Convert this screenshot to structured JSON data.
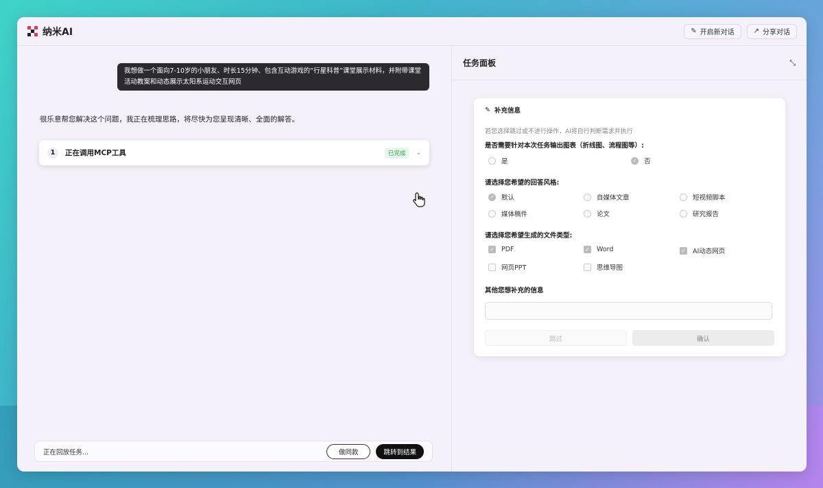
{
  "app": {
    "name": "纳米AI"
  },
  "topbar": {
    "new_chat": "开启新对话",
    "share": "分享对话"
  },
  "chat": {
    "user_message": "我想做一个面向7-10岁的小朋友、时长15分钟、包含互动游戏的“行星科普”课堂展示材料，并附带课堂活动教案和动态展示太阳系运动交互网页",
    "ai_message": "很乐意帮您解决这个问题，我正在梳理思路，将尽快为您呈现清晰、全面的解答。",
    "tool_step": {
      "number": "1",
      "title": "正在调用MCP工具",
      "status": "已完成"
    }
  },
  "bottom_bar": {
    "status": "正在回放任务...",
    "same_button": "做同款",
    "jump_button": "跳转到结果"
  },
  "panel": {
    "title": "任务面板",
    "form": {
      "header": "补充信息",
      "hint": "若您选择跳过或不进行操作，AI将自行判断需求并执行",
      "q1": {
        "label": "是否需要针对本次任务输出图表（折线图、流程图等）:",
        "options": [
          "是",
          "否"
        ],
        "selected": "否"
      },
      "q2": {
        "label": "请选择您希望的回答风格:",
        "options": [
          "默认",
          "自媒体文章",
          "短视频脚本",
          "媒体稿件",
          "论文",
          "研究报告"
        ],
        "selected": "默认"
      },
      "q3": {
        "label": "请选择您希望生成的文件类型:",
        "options": [
          "PDF",
          "Word",
          "AI动态网页",
          "网页PPT",
          "思维导图"
        ],
        "checked": [
          "PDF",
          "Word",
          "AI动态网页"
        ]
      },
      "q4": {
        "label": "其他您想补充的信息"
      },
      "skip": "跳过",
      "confirm": "确认"
    }
  },
  "colors": {
    "done": "#2fa55a",
    "dark_button": "#111111"
  }
}
